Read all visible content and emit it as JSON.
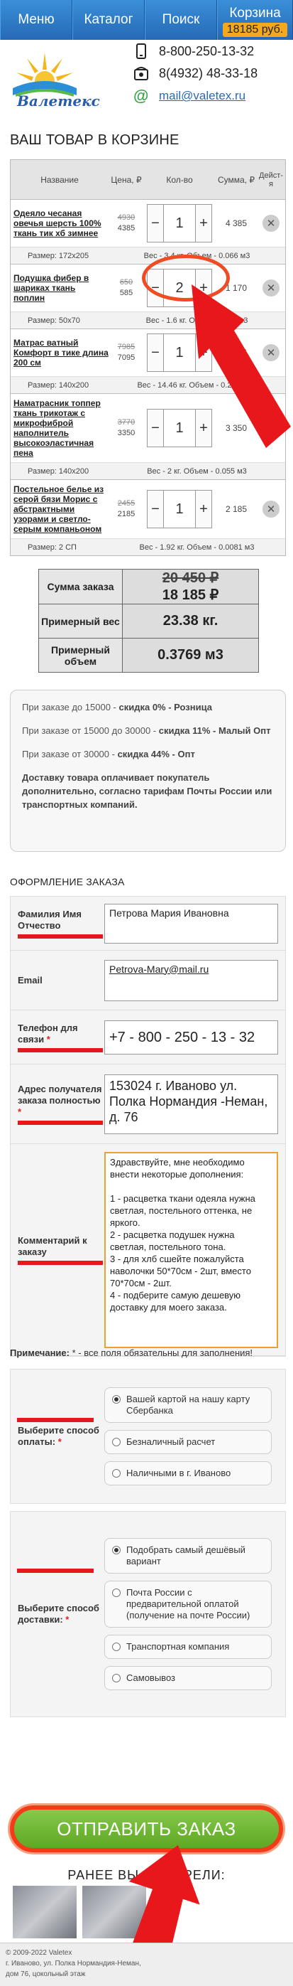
{
  "nav": {
    "menu": "Меню",
    "catalog": "Каталог",
    "search": "Поиск",
    "cart": "Корзина",
    "cart_total": "18185 руб."
  },
  "header": {
    "logo_text": "Валетекс",
    "phone1": "8-800-250-13-32",
    "phone2": "8(4932) 48-33-18",
    "email": "mail@valetex.ru"
  },
  "cart": {
    "title": "ВАШ ТОВАР В КОРЗИНЕ",
    "columns": [
      "Название",
      "Цена, ₽",
      "Кол-во",
      "Сумма, ₽",
      "Дейст-я"
    ],
    "items": [
      {
        "name": "Одеяло чесаная овечья шерсть 100% ткань тик хб зимнее",
        "old_price": "4930",
        "price": "4385",
        "qty": "1",
        "sum": "4 385",
        "size": "Размер: 172x205",
        "meta": "Вес - 3.4 кг. Объем - 0.066 м3"
      },
      {
        "name": "Подушка фибер в шариках ткань поплин",
        "old_price": "650",
        "price": "585",
        "qty": "2",
        "sum": "1 170",
        "size": "Размер: 50x70",
        "meta": "Вес - 1.6 кг. Объем - 0.06 м3"
      },
      {
        "name": "Матрас ватный Комфорт в тике длина 200 см",
        "old_price": "7985",
        "price": "7095",
        "qty": "1",
        "sum": "7 095",
        "size": "Размер: 140x200",
        "meta": "Вес - 14.46 кг. Объем - 0.2128 м3"
      },
      {
        "name": "Наматрасник топпер ткань трикотаж с микрофиброй наполнитель высокоэластичная пена",
        "old_price": "3770",
        "price": "3350",
        "qty": "1",
        "sum": "3 350",
        "size": "Размер: 140x200",
        "meta": "Вес - 2 кг. Объем - 0.055 м3"
      },
      {
        "name": "Постельное белье из серой бязи Морис с абстрактными узорами и светло-серым компаньоном",
        "old_price": "2455",
        "price": "2185",
        "qty": "1",
        "sum": "2 185",
        "size": "Размер: 2 СП",
        "meta": "Вес - 1.92 кг. Объем - 0.0081 м3"
      }
    ]
  },
  "totals": {
    "sum_label": "Сумма заказа",
    "sum_old": "20 450 ₽",
    "sum_new": "18 185 ₽",
    "weight_label": "Примерный вес",
    "weight": "23.38 кг.",
    "volume_label": "Примерный объем",
    "volume": "0.3769 м3"
  },
  "info": {
    "line1_pre": "При заказе до 15000 - ",
    "line1_b": "скидка 0% - Розница",
    "line2_pre": "При заказе от 15000 до 30000 - ",
    "line2_b": "скидка 11% - Малый Опт",
    "line3_pre": "При заказе от 30000 - ",
    "line3_b": "скидка 44% - Опт",
    "line4": "Доставку товара оплачивает покупатель дополнительно, согласно тарифам Почты России или транспортных компаний."
  },
  "form": {
    "title": "ОФОРМЛЕНИЕ ЗАКАЗА",
    "name_label": "Фамилия Имя Отчество",
    "name_value": "Петрова Мария Ивановна",
    "email_label": "Email",
    "email_value": "Petrova-Mary@mail.ru",
    "phone_label": "Телефон для связи",
    "phone_value": "+7 - 800 - 250 - 13 - 32",
    "address_label": "Адрес получателя заказа полностью",
    "address_value": "153024 г. Иваново ул. Полка Нормандия -Неман, д. 76",
    "comment_label": "Комментарий к заказу",
    "comment_value": "Здравствуйте, мне необходимо внести некоторые дополнения:\n\n1 - расцветка ткани одеяла нужна светлая, постельного оттенка, не яркого.\n2 - расцветка подушек нужна светлая, постельного тона.\n3 - для хлб сшейте пожалуйста наволочки 50*70см - 2шт, вместо 70*70см - 2шт.\n4 - подберите самую дешевую доставку для моего заказа.",
    "note_b": "Примечание:",
    "note_text": " * - все поля обязательны для заполнения!",
    "payment_label": "Выберите способ оплаты:",
    "payment_options": [
      "Вашей картой на нашу карту Сбербанка",
      "Безналичный расчет",
      "Наличными в г. Иваново"
    ],
    "delivery_label": "Выберите способ доставки:",
    "delivery_options": [
      "Подобрать самый дешёвый вариант",
      "Почта России с предварительной оплатой (получение на почте России)",
      "Транспортная компания",
      "Самовывоз"
    ]
  },
  "submit_label": "ОТПРАВИТЬ ЗАКАЗ",
  "viewed_title": "РАНЕЕ ВЫ СМОТРЕЛИ:",
  "footer": {
    "line1": "© 2009-2022 Valetex",
    "line2": "г. Иваново, ул. Полка Нормандия-Неман,",
    "line3": "дом 76, цокольный этаж"
  },
  "colors": {
    "nav_blue": "#2a72c0",
    "accent_green": "#6ab32e",
    "annotation_red": "#e8171c"
  }
}
